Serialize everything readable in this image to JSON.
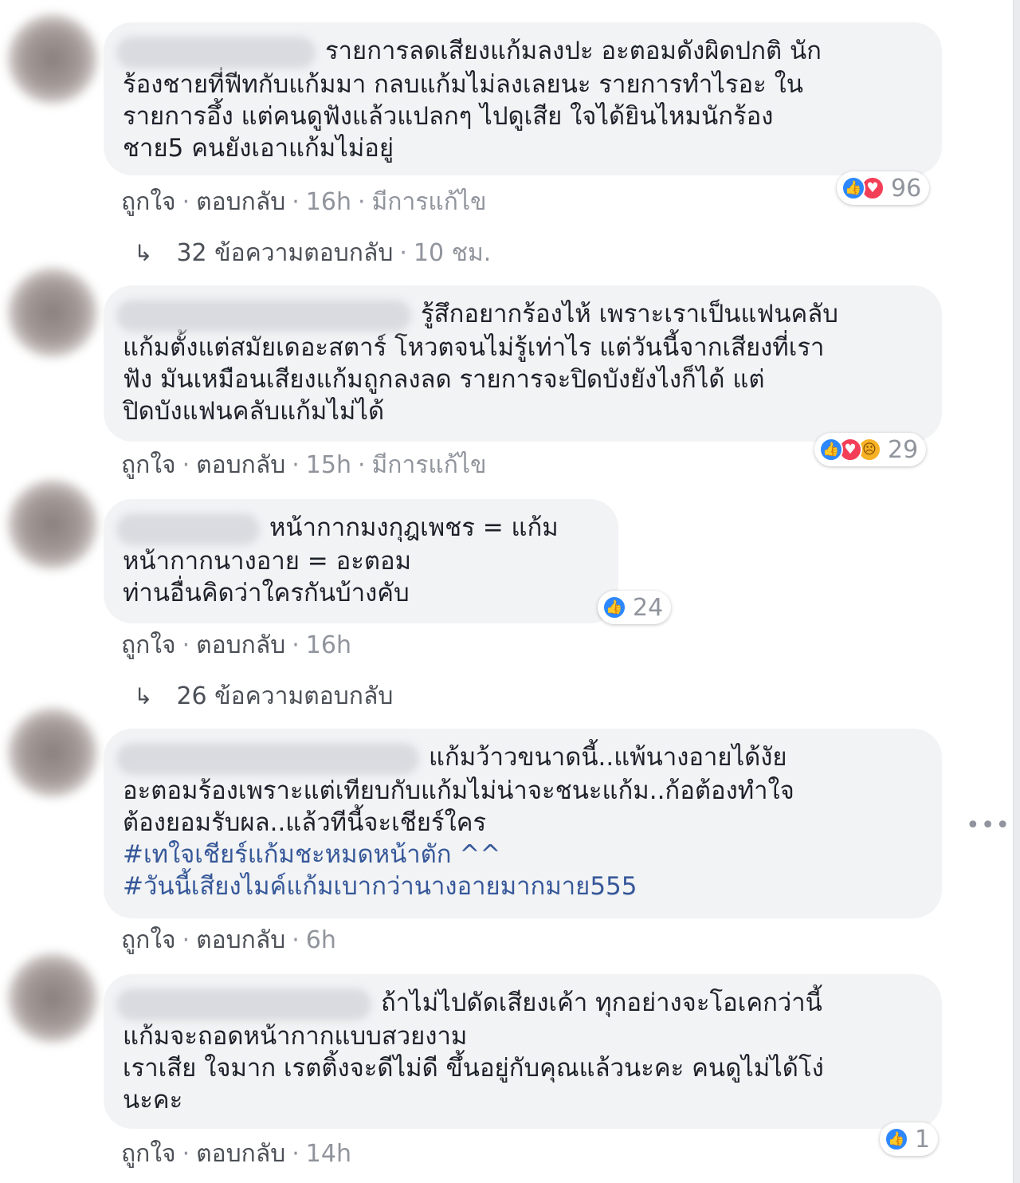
{
  "comments": [
    {
      "name_text": "",
      "lines": [
        "รายการลดเสียงแก้มลงปะ อะตอมดังผิดปกติ นัก",
        "ร้องชายที่ฟีทกับแก้มมา กลบแก้มไม่ลงเลยนะ รายการทำไรอะ ใน",
        "รายการอึ้ง แต่คนดูฟังแล้วแปลกๆ ไปดูเสีย ใจได้ยินไหมนักร้อง",
        "ชาย5 คนยังเอาแก้มไม่อยู่"
      ],
      "reaction_count": "96",
      "actions": {
        "like": "ถูกใจ",
        "reply": "ตอบกลับ",
        "time": "16h",
        "edited": "มีการแก้ไข"
      },
      "replies": {
        "label": "32 ข้อความตอบกลับ",
        "time": "10 ชม."
      }
    },
    {
      "lines": [
        "รู้สึกอยากร้องไห้ เพราะเราเป็นแฟนคลับ",
        "แก้มตั้งแต่สมัยเดอะสตาร์ โหวตจนไม่รู้เท่าไร แต่วันนี้จากเสียงที่เรา",
        "ฟัง มันเหมือนเสียงแก้มถูกลงลด รายการจะปิดบังยังไงก็ได้ แต่",
        "ปิดบังแฟนคลับแก้มไม่ได้"
      ],
      "reaction_count": "29",
      "actions": {
        "like": "ถูกใจ",
        "reply": "ตอบกลับ",
        "time": "15h",
        "edited": "มีการแก้ไข"
      }
    },
    {
      "lines": [
        "หน้ากากมงกุฎเพชร = แก้ม",
        "หน้ากากนางอาย = อะตอม",
        "ท่านอื่นคิดว่าใครกันบ้างคับ"
      ],
      "reaction_count": "24",
      "actions": {
        "like": "ถูกใจ",
        "reply": "ตอบกลับ",
        "time": "16h"
      },
      "replies": {
        "label": "26 ข้อความตอบกลับ"
      }
    },
    {
      "lines": [
        "แก้มว้าวขนาดนี้..แพ้นางอายได้งัย",
        "อะตอมร้องเพราะแต่เทียบกับแก้มไม่น่าจะชนะแก้ม..ก้อต้องทำใจ",
        "ต้องยอมรับผล..แล้วทีนี้จะเชียร์ใคร"
      ],
      "hashtags": [
        "#เทใจเชียร์แก้มชะหมดหน้าตัก ^^",
        "#วันนี้เสียงไมค์แก้มเบากว่านางอายมากมาย555"
      ],
      "actions": {
        "like": "ถูกใจ",
        "reply": "ตอบกลับ",
        "time": "6h"
      }
    },
    {
      "lines": [
        "ถ้าไม่ไปดัดเสียงเค้า ทุกอย่างจะโอเคกว่านี้",
        "แก้มจะถอดหน้ากากแบบสวยงาม",
        "เราเสีย ใจมาก เรตติ้งจะดีไม่ดี ขึ้นอยู่กับคุณแล้วนะคะ คนดูไม่ได้โง่",
        "นะคะ"
      ],
      "reaction_count": "1",
      "actions": {
        "like": "ถูกใจ",
        "reply": "ตอบกลับ",
        "time": "14h"
      }
    }
  ],
  "dot": "·",
  "reply_arrow": "↳",
  "more_options": "•••",
  "reaction_icons": {
    "like": "like-icon",
    "love": "love-icon",
    "sad": "sad-icon"
  },
  "colors": {
    "bubble": "#f2f3f5",
    "meta": "#90949c",
    "hashtag": "#365899",
    "like_blue": "#2d88ff",
    "love_red": "#f33e58"
  }
}
